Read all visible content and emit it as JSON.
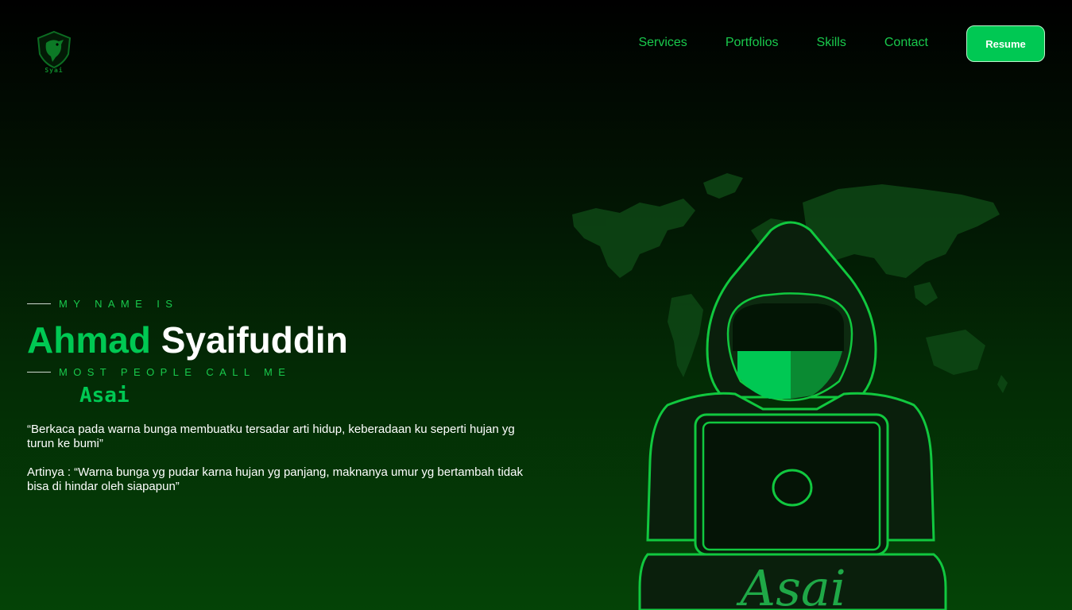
{
  "header": {
    "logo_text": "Syai",
    "nav": [
      "Services",
      "Portfolios",
      "Skills",
      "Contact"
    ],
    "resume_label": "Resume"
  },
  "hero": {
    "intro": "MY NAME IS",
    "first_name": "Ahmad",
    "last_name": "Syaifuddin",
    "call_label": "MOST PEOPLE CALL ME",
    "nickname": "Asai",
    "quote": "“Berkaca pada warna bunga membuatku tersadar arti hidup, keberadaan ku seperti hujan yg turun ke bumi”",
    "meaning": "Artinya : “Warna bunga yg pudar karna hujan yg panjang, maknanya umur yg bertambah tidak bisa di hindar oleh siapapun”"
  },
  "illustration": {
    "caption": "Asai",
    "icon": "hooded-hacker-laptop",
    "background": "world-map"
  },
  "colors": {
    "accent": "#00c853",
    "nav_text": "#19c94c",
    "background_top": "#000000",
    "background_bottom": "#044306"
  }
}
